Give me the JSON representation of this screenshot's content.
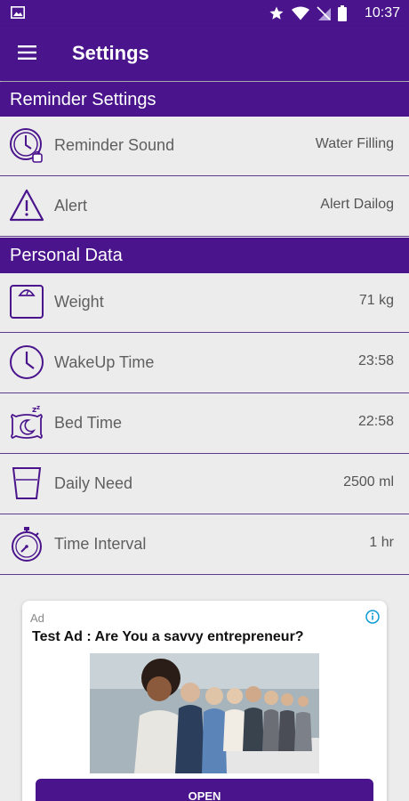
{
  "status_bar": {
    "time": "10:37",
    "icons": [
      "image-icon",
      "star-icon",
      "wifi-icon",
      "no-sim-icon",
      "battery-icon"
    ]
  },
  "app_bar": {
    "title": "Settings",
    "menu_icon": "menu-icon"
  },
  "sections": {
    "reminder": {
      "title": "Reminder Settings",
      "items": [
        {
          "label": "Reminder Sound",
          "value": "Water Filling",
          "icon": "alarm-clock-icon"
        },
        {
          "label": "Alert",
          "value": "Alert Dailog",
          "icon": "warning-icon"
        }
      ]
    },
    "personal": {
      "title": "Personal Data",
      "items": [
        {
          "label": "Weight",
          "value": "71  kg",
          "icon": "scale-icon"
        },
        {
          "label": "WakeUp Time",
          "value": "23:58",
          "icon": "clock-icon"
        },
        {
          "label": "Bed Time",
          "value": "22:58",
          "icon": "sleep-icon"
        },
        {
          "label": "Daily Need",
          "value": "2500  ml",
          "icon": "water-glass-icon"
        },
        {
          "label": "Time Interval",
          "value": "1  hr",
          "icon": "stopwatch-icon"
        }
      ]
    }
  },
  "ad": {
    "tag": "Ad",
    "headline": "Test Ad : Are You a savvy entrepreneur?",
    "button": "OPEN"
  },
  "colors": {
    "primary": "#4a148c",
    "background": "#ececec",
    "text": "#5f5f5f"
  }
}
